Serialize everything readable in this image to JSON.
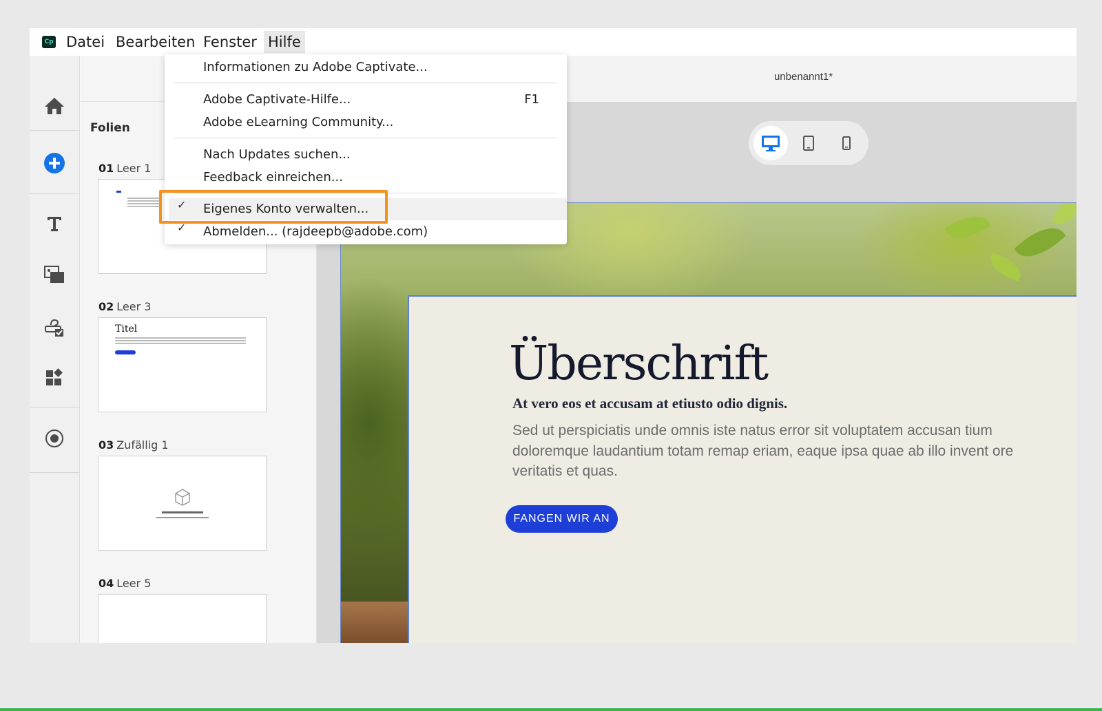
{
  "app": {
    "logo_text": "Cp",
    "document_title": "unbenannt1*"
  },
  "menubar": {
    "items": [
      {
        "label": "Datei"
      },
      {
        "label": "Bearbeiten"
      },
      {
        "label": "Fenster"
      },
      {
        "label": "Hilfe",
        "active": true
      }
    ]
  },
  "help_menu": {
    "items": [
      {
        "label": "Informationen zu Adobe Captivate...",
        "shortcut": "",
        "checked": false
      },
      {
        "label": "Adobe Captivate-Hilfe...",
        "shortcut": "F1",
        "checked": false
      },
      {
        "label": "Adobe eLearning Community...",
        "shortcut": "",
        "checked": false
      },
      {
        "label": "Nach Updates suchen...",
        "shortcut": "",
        "checked": false
      },
      {
        "label": "Feedback einreichen...",
        "shortcut": "",
        "checked": false
      },
      {
        "label": "Eigenes Konto verwalten...",
        "shortcut": "",
        "checked": true,
        "highlighted": true
      },
      {
        "label": "Abmelden... (rajdeepb@adobe.com)",
        "shortcut": "",
        "checked": true
      }
    ],
    "check_glyph": "✓"
  },
  "sidebar": {
    "icons": [
      "home-icon",
      "add-icon",
      "text-icon",
      "media-icon",
      "quiz-icon",
      "widgets-icon",
      "record-icon"
    ]
  },
  "slides_panel": {
    "title": "Folien",
    "slides": [
      {
        "number": "01",
        "name": "Leer 1"
      },
      {
        "number": "02",
        "name": "Leer 3",
        "thumb_title": "Titel"
      },
      {
        "number": "03",
        "name": "Zufällig 1"
      },
      {
        "number": "04",
        "name": "Leer 5"
      }
    ]
  },
  "device_bar": {
    "items": [
      "desktop-icon",
      "tablet-icon",
      "phone-icon"
    ],
    "active": "desktop-icon"
  },
  "slide_content": {
    "headline": "Überschrift",
    "subheadline": "At vero eos et accusam at etiusto odio dignis.",
    "body": "Sed ut perspiciatis unde omnis iste natus error sit voluptatem accusan tium doloremque laudantium totam remap eriam, eaque ipsa quae ab illo invent ore veritatis et quas.",
    "cta_label": "FANGEN WIR AN"
  },
  "colors": {
    "accent_blue": "#1d3fd8",
    "highlight_orange": "#f5921e",
    "icon_add_blue": "#1473e6"
  }
}
